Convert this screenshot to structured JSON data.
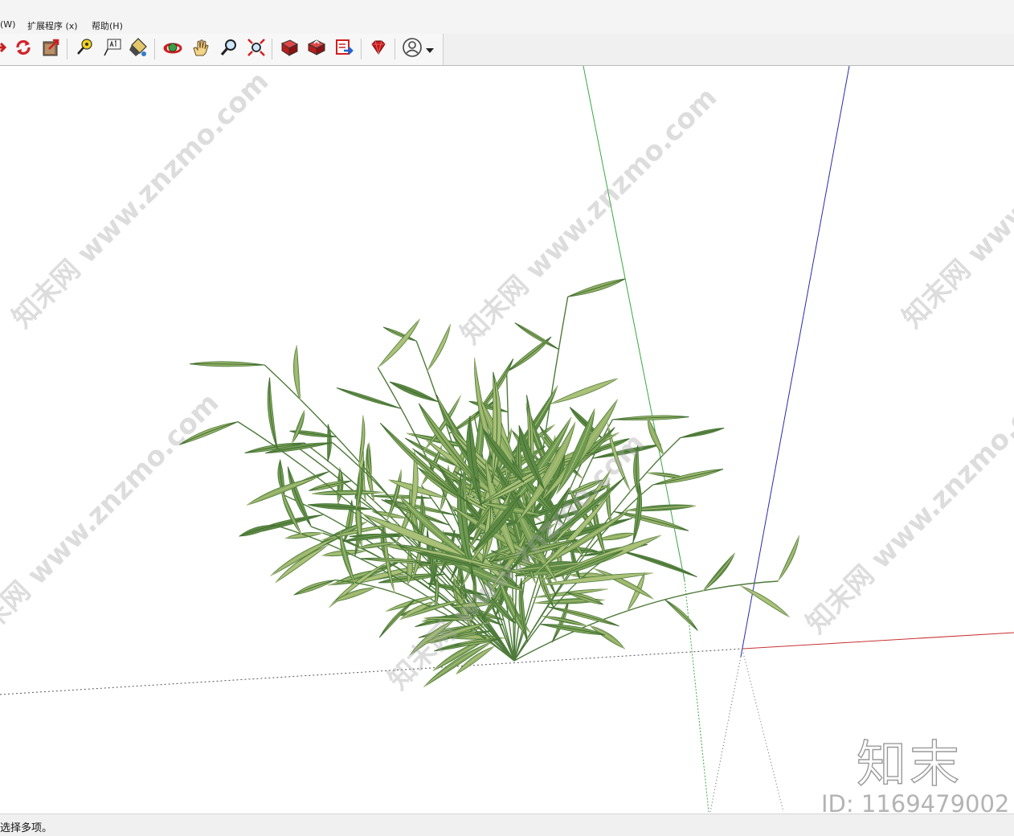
{
  "menu": {
    "items": [
      "(W)",
      "扩展程序 (x)",
      "帮助(H)"
    ]
  },
  "toolbar": {
    "tools": [
      {
        "name": "orbit-arrow-icon"
      },
      {
        "name": "refresh-icon"
      },
      {
        "name": "export-icon"
      },
      {
        "name": "tape-measure-icon"
      },
      {
        "name": "text-label-icon"
      },
      {
        "name": "paint-bucket-icon"
      },
      {
        "name": "orbit-icon"
      },
      {
        "name": "pan-hand-icon"
      },
      {
        "name": "zoom-icon"
      },
      {
        "name": "zoom-extents-icon"
      },
      {
        "name": "warehouse-icon"
      },
      {
        "name": "share-model-icon"
      },
      {
        "name": "extension-warehouse-icon"
      },
      {
        "name": "ruby-icon"
      },
      {
        "name": "user-account-icon"
      }
    ]
  },
  "colors": {
    "axis_green": "#3aa845",
    "axis_blue": "#2a2aa8",
    "axis_red": "#c83232",
    "leaf_dark": "#4d7a3a",
    "leaf_light": "#b3c27d"
  },
  "watermark": {
    "text": "知末网 www.znzmo.com",
    "brand": "知末",
    "id": "ID: 1169479002"
  },
  "status": {
    "text": "选择多项。"
  }
}
